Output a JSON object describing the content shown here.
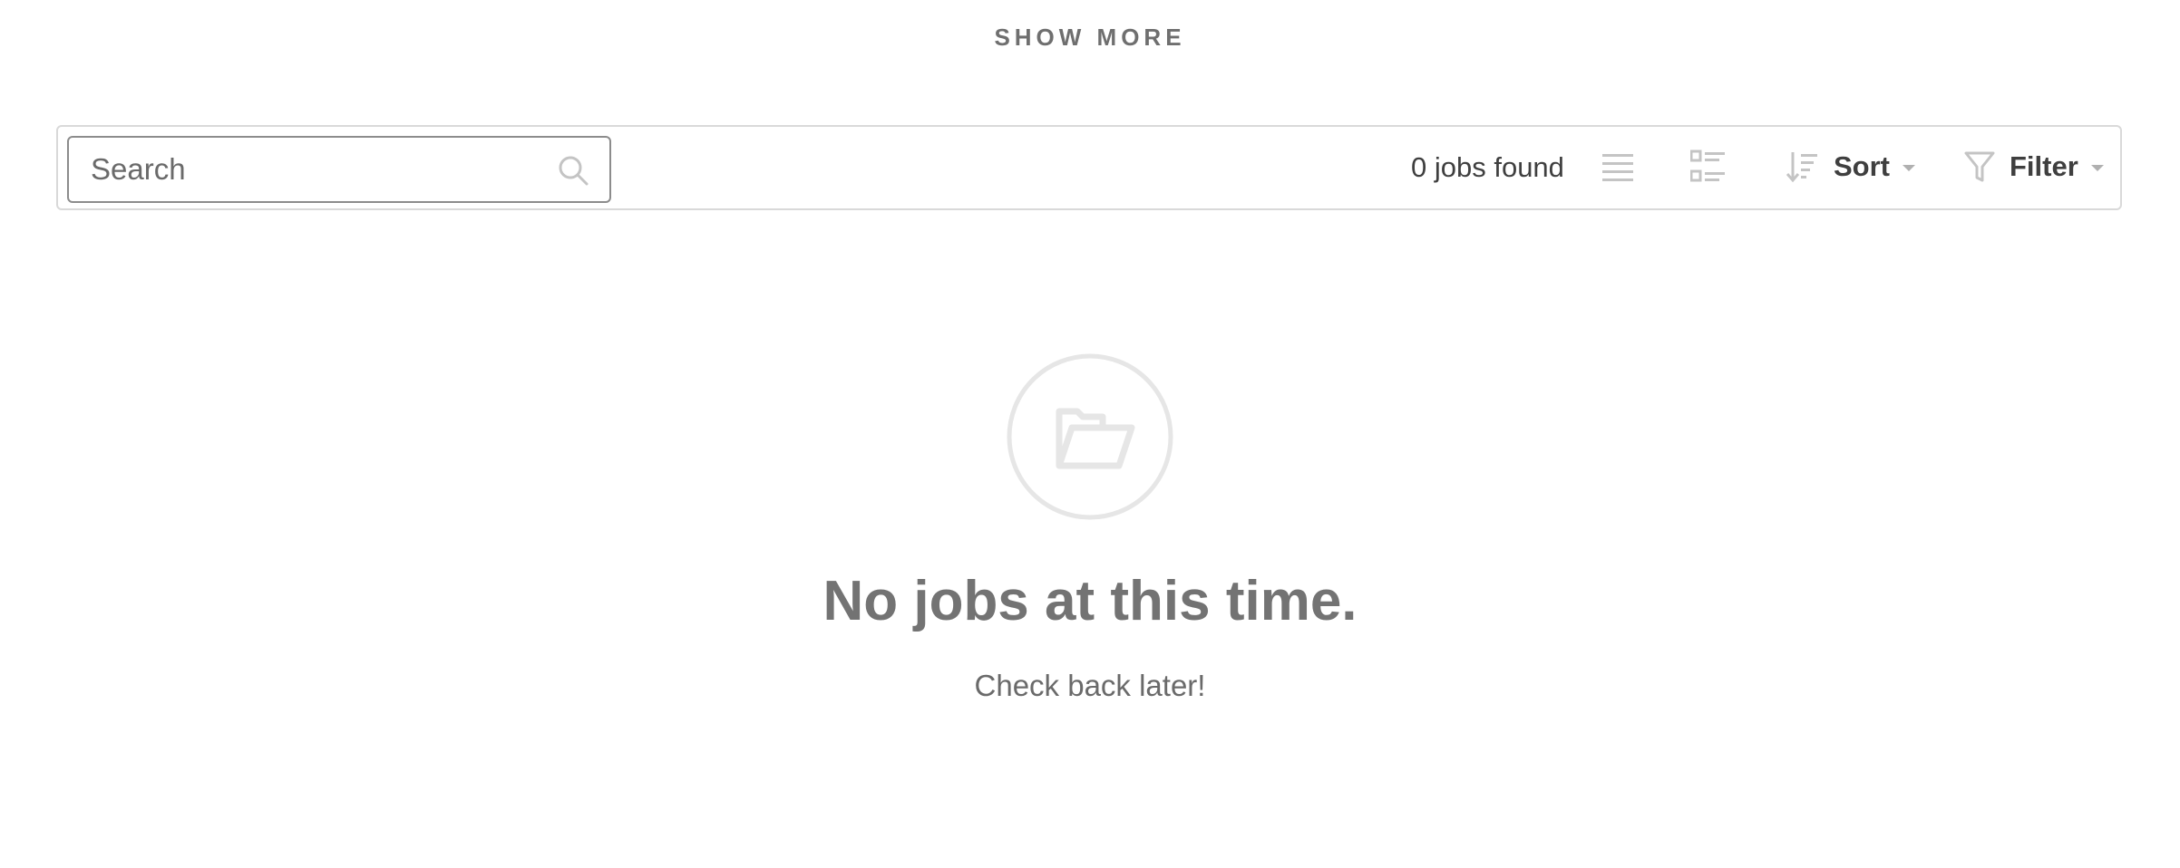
{
  "header": {
    "show_more_label": "SHOW MORE"
  },
  "toolbar": {
    "search": {
      "placeholder": "Search",
      "value": "",
      "icon": "search-icon"
    },
    "jobs_count_text": "0 jobs found",
    "view_options": [
      {
        "icon": "list-view-icon"
      },
      {
        "icon": "detail-view-icon"
      }
    ],
    "sort": {
      "label": "Sort",
      "icon": "sort-icon"
    },
    "filter": {
      "label": "Filter",
      "icon": "filter-icon"
    }
  },
  "empty_state": {
    "icon": "folder-open-icon",
    "title": "No jobs at this time.",
    "subtitle": "Check back later!"
  },
  "colors": {
    "text_dark": "#3f3f3f",
    "text_muted": "#737373",
    "border": "#d9d9d9",
    "icon_light": "#c4c4c4"
  }
}
